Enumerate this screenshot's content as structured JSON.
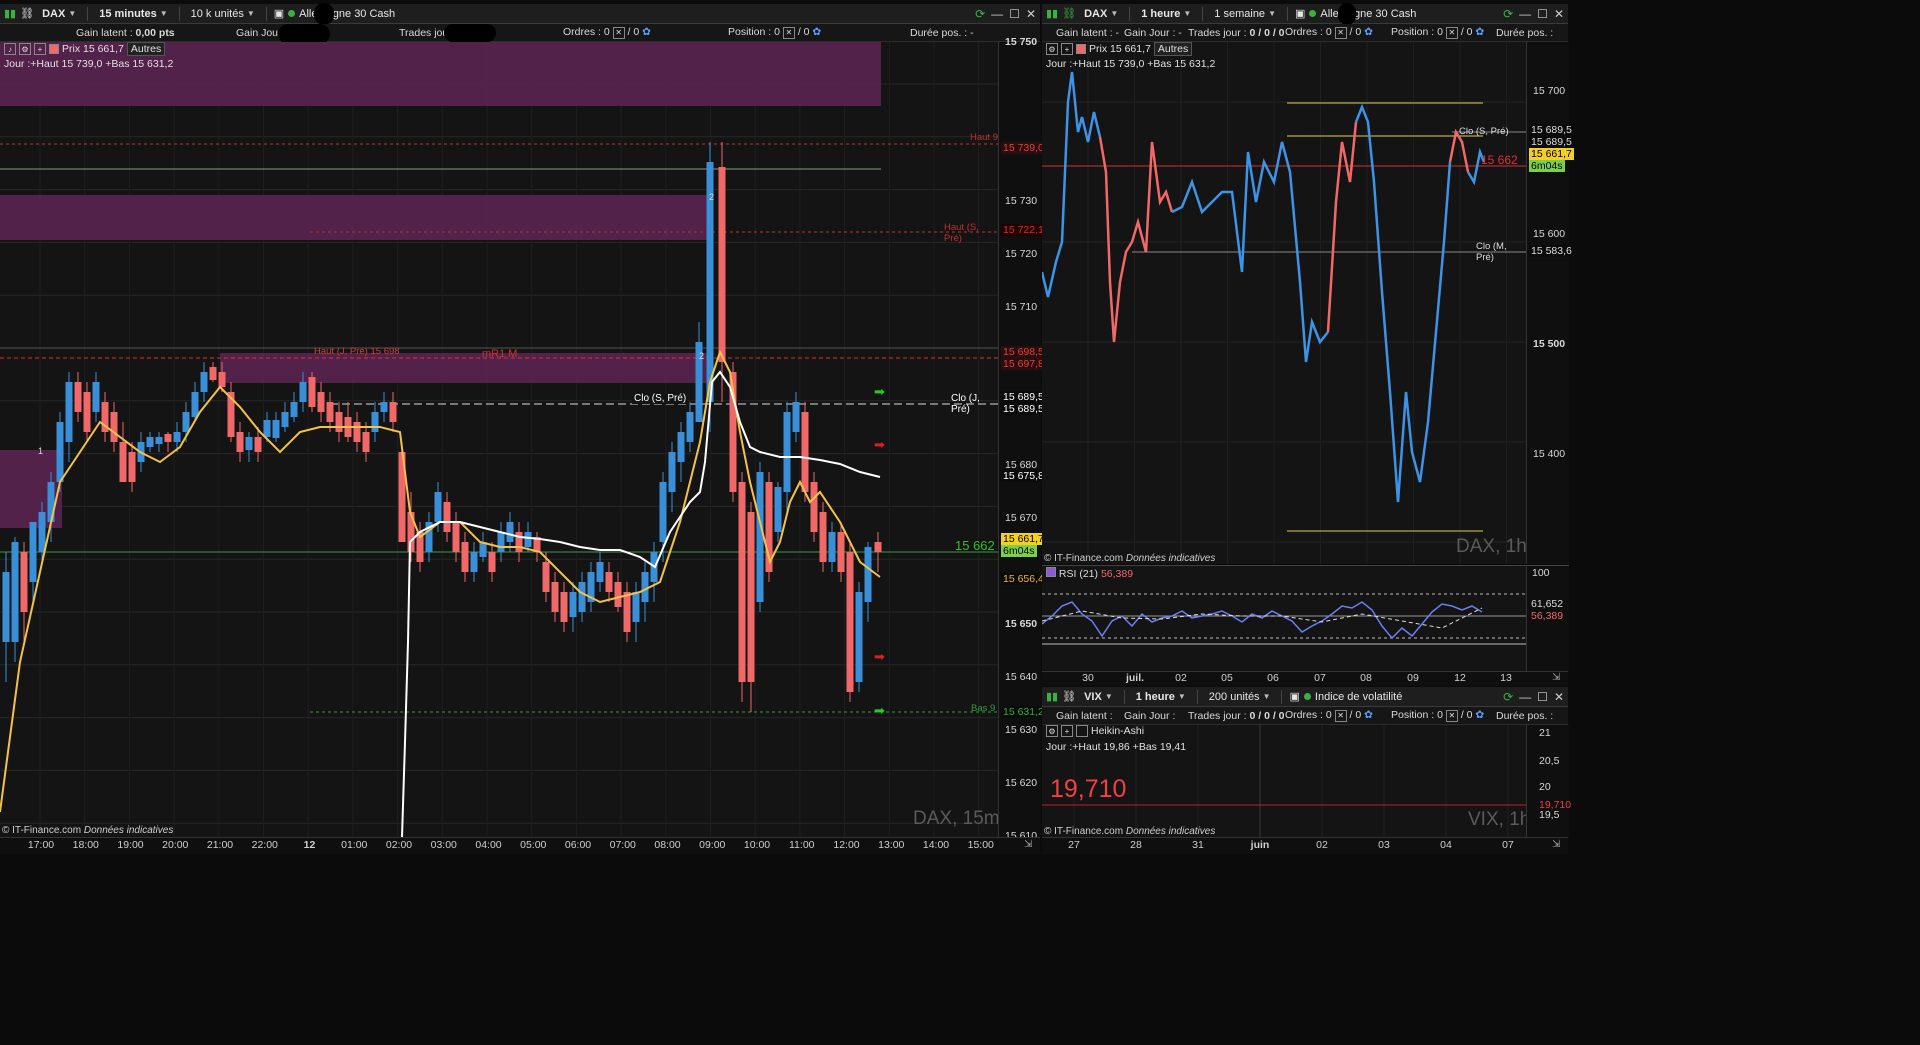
{
  "left": {
    "toolbar": {
      "symbol": "DAX",
      "timeframe": "15 minutes",
      "units": "10 k unités",
      "instrument": "Allemagne 30 Cash"
    },
    "info": {
      "latent_label": "Gain latent :",
      "latent_value": "0,00 pts",
      "gain_jour": "Gain Jour :",
      "trades_jour": "Trades jour :",
      "ordres": "Ordres :",
      "ordres_value": "0",
      "ordres_value2": "/ 0",
      "position": "Position :",
      "position_value": "0",
      "position_value2": "/ 0",
      "duree": "Durée pos. :",
      "duree_value": "-"
    },
    "legend": {
      "prix": "Prix 15 661,7",
      "autres": "Autres",
      "jour": "Jour :+Haut 15 739,0 +Bas 15 631,2"
    },
    "y_labels": [
      "15 750",
      "15 740",
      "15 730",
      "15 720",
      "15 710",
      "15 700",
      "15 680",
      "15 670",
      "15 650",
      "15 640",
      "15 630",
      "15 620",
      "15 610"
    ],
    "price_levels": [
      {
        "text": "15 739,0",
        "color": "#e04040",
        "bg": "#2a0d0d"
      },
      {
        "text": "15 722,1",
        "color": "#d03030",
        "bg": "#200"
      },
      {
        "text": "15 698,5",
        "color": "#e04040",
        "bg": "#2a0d0d"
      },
      {
        "text": "15 697,8",
        "color": "#e04040",
        "bg": "#2a0d0d"
      },
      {
        "text": "15 689,5",
        "color": "#fff",
        "bg": "#0b0b0b"
      },
      {
        "text": "15 689,5",
        "color": "#fff",
        "bg": "#0b0b0b"
      },
      {
        "text": "15 675,8",
        "color": "#fff",
        "bg": "#0b0b0b"
      },
      {
        "text": "15 661,7",
        "color": "#000",
        "bg": "#f5d020"
      },
      {
        "text": "6m04s",
        "color": "#000",
        "bg": "#7ccf4a"
      },
      {
        "text": "15 656,4",
        "color": "#f0b040",
        "bg": "#0b0b0b"
      },
      {
        "text": "15 631,2",
        "color": "#30b030",
        "bg": "#0b0b0b"
      }
    ],
    "annotations": {
      "haut_j": "Haut (J, Pré) 15 698",
      "mr1": "mR1 M",
      "clo_s": "Clo (S, Pré)",
      "clo_j": "Clo (J, Pré)",
      "haut_s": "Haut (S, Pré)",
      "haut_top": "Haut 9",
      "bas": "Bas 9",
      "p15662": "15 662",
      "one": "1",
      "two": "2",
      "two_b": "2"
    },
    "x_labels": [
      "17:00",
      "18:00",
      "19:00",
      "20:00",
      "21:00",
      "22:00",
      "12",
      "01:00",
      "02:00",
      "03:00",
      "04:00",
      "05:00",
      "06:00",
      "07:00",
      "08:00",
      "09:00",
      "10:00",
      "11:00",
      "12:00",
      "13:00",
      "14:00",
      "15:00"
    ],
    "watermark": "DAX, 15m",
    "credit_a": "© IT-Finance.com",
    "credit_b": "Données indicatives"
  },
  "right_top": {
    "toolbar": {
      "symbol": "DAX",
      "timeframe": "1 heure",
      "period": "1 semaine",
      "instrument": "Allemagne 30 Cash"
    },
    "info": {
      "latent": "Gain latent :",
      "latent_value": "-",
      "gain_jour": "Gain Jour :",
      "gain_jour_value": "-",
      "trades_jour": "Trades jour :",
      "trades_value": "0 / 0 / 0",
      "ordres": "Ordres :",
      "ordres_value": "0",
      "ordres_value2": "/ 0",
      "position": "Position :",
      "position_value": "0",
      "position_value2": "/ 0",
      "duree": "Durée pos. :"
    },
    "legend": {
      "prix": "Prix 15 661,7",
      "autres": "Autres",
      "jour": "Jour :+Haut 15 739,0 +Bas 15 631,2"
    },
    "y_labels": [
      "15 700",
      "15 600",
      "15 500",
      "15 400"
    ],
    "price_levels": [
      {
        "text": "15 689,5",
        "color": "#ddd",
        "bg": "#0b0b0b"
      },
      {
        "text": "15 689,5",
        "color": "#ddd",
        "bg": "#0b0b0b"
      },
      {
        "text": "15 661,7",
        "color": "#000",
        "bg": "#f5d020"
      },
      {
        "text": "6m04s",
        "color": "#000",
        "bg": "#7ccf4a"
      },
      {
        "text": "15 583,6",
        "color": "#ddd",
        "bg": "#0b0b0b"
      }
    ],
    "annotations": {
      "clo_s": "Clo (S, Pré)",
      "clo_m": "Clo (M, Pré)",
      "p15662": "15 662"
    },
    "watermark": "DAX, 1h",
    "credit_a": "© IT-Finance.com",
    "credit_b": "Données indicatives",
    "rsi": {
      "label": "RSI (21)",
      "value": "56,389",
      "top": "100",
      "v1": "61,652",
      "v2": "56,389"
    },
    "x_labels": [
      "30",
      "juil.",
      "02",
      "05",
      "06",
      "07",
      "08",
      "09",
      "12",
      "13"
    ]
  },
  "right_bottom": {
    "toolbar": {
      "symbol": "VIX",
      "timeframe": "1 heure",
      "units": "200 unités",
      "instrument": "Indice de volatilité"
    },
    "info": {
      "latent": "Gain latent :",
      "gain_jour": "Gain Jour :",
      "trades_jour": "Trades jour :",
      "trades_value": "0 / 0 / 0",
      "ordres": "Ordres :",
      "ordres_value": "0",
      "ordres_value2": "/ 0",
      "position": "Position :",
      "position_value": "0",
      "position_value2": "/ 0",
      "duree": "Durée pos. :"
    },
    "heikin": "Heikin-Ashi",
    "jour": "Jour :+Haut 19,86 +Bas 19,41",
    "big_value": "19,710",
    "y_labels": [
      "21",
      "20,5",
      "20",
      "19,5"
    ],
    "price_level": "19,710",
    "watermark": "VIX, 1h",
    "credit_a": "© IT-Finance.com",
    "credit_b": "Données indicatives",
    "x_labels": [
      "27",
      "28",
      "31",
      "juin",
      "02",
      "03",
      "04",
      "07"
    ]
  },
  "colors": {
    "bull": "#3a8fd9",
    "bear": "#f06868",
    "ma_fast": "#f2c24a",
    "ma_slow": "#ffffff",
    "zone": "#5a2350",
    "line_blue": "#3d93e6",
    "line_red": "#f06868"
  }
}
